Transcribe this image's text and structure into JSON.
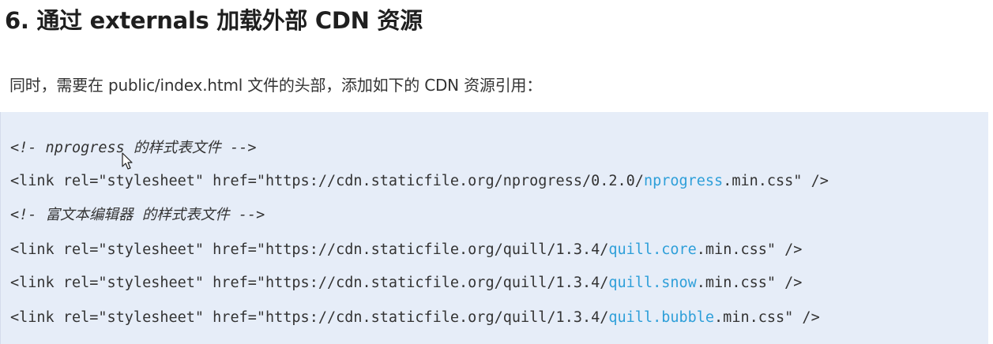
{
  "heading": "6. 通过 externals 加载外部 CDN 资源",
  "paragraph": "同时，需要在 public/index.html 文件的头部，添加如下的 CDN 资源引用：",
  "code_lines": [
    {
      "kind": "comment",
      "text": "<!- nprogress 的样式表文件 -->"
    },
    {
      "kind": "link",
      "prefix": "<link rel=\"stylesheet\" href=\"https://cdn.staticfile.org/nprogress/0.2.0/",
      "highlight": "nprogress",
      "suffix": ".min.css\" />"
    },
    {
      "kind": "comment",
      "text": "<!- 富文本编辑器 的样式表文件 -->"
    },
    {
      "kind": "link",
      "prefix": "<link rel=\"stylesheet\" href=\"https://cdn.staticfile.org/quill/1.3.4/",
      "highlight": "quill.core",
      "suffix": ".min.css\" />"
    },
    {
      "kind": "link",
      "prefix": "<link rel=\"stylesheet\" href=\"https://cdn.staticfile.org/quill/1.3.4/",
      "highlight": "quill.snow",
      "suffix": ".min.css\" />"
    },
    {
      "kind": "link",
      "prefix": "<link rel=\"stylesheet\" href=\"https://cdn.staticfile.org/quill/1.3.4/",
      "highlight": "quill.bubble",
      "suffix": ".min.css\" />"
    }
  ],
  "colors": {
    "code_background": "#e6edf8",
    "highlight": "#2e9fd9",
    "text": "#333333"
  },
  "icons": {
    "cursor": "mouse-pointer-icon"
  }
}
